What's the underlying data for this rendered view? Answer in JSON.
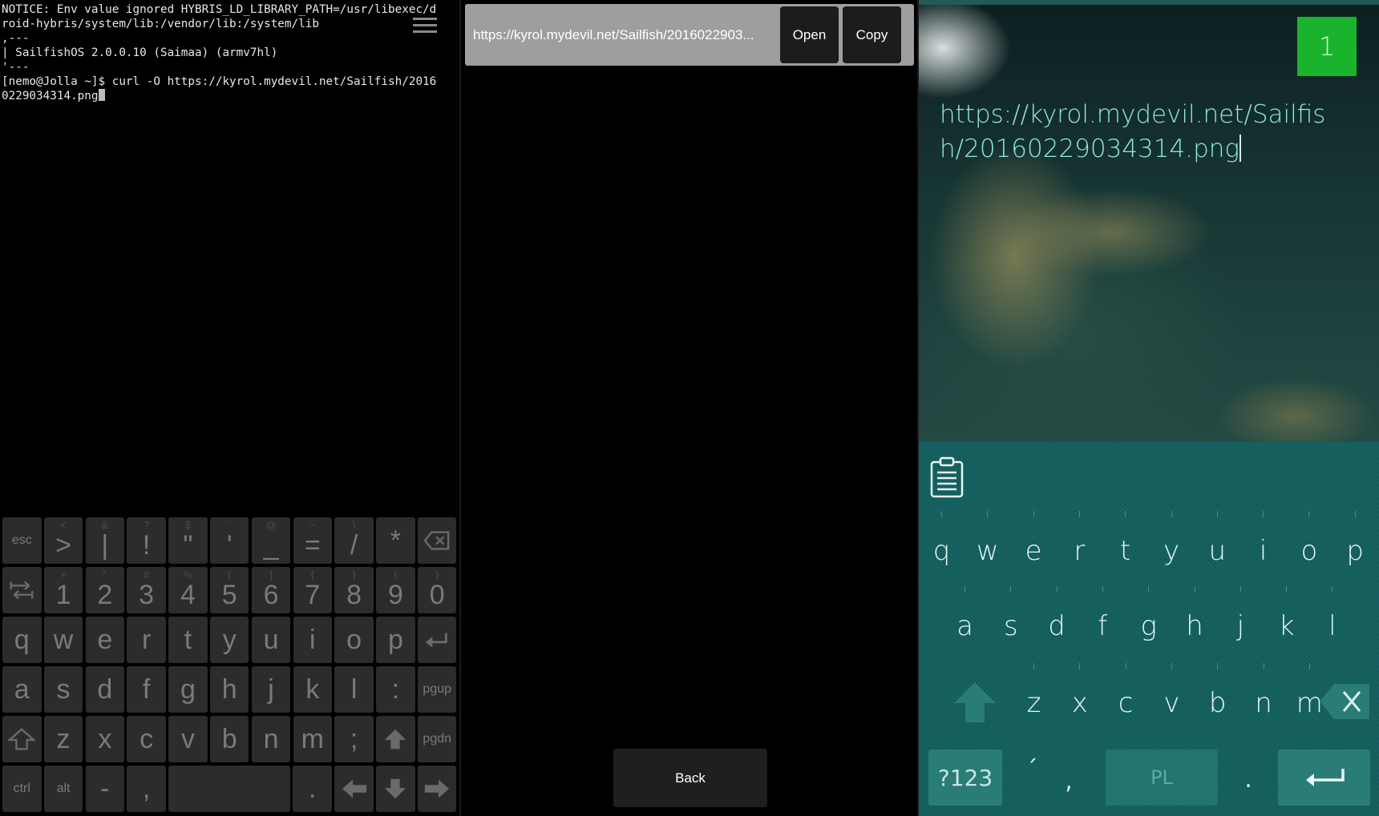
{
  "terminal": {
    "lines": [
      "NOTICE: Env value ignored HYBRIS_LD_LIBRARY_PATH=/usr/libexec/d",
      "roid-hybris/system/lib:/vendor/lib:/system/lib",
      ",---",
      "| SailfishOS 2.0.0.10 (Saimaa) (armv7hl)",
      "'---",
      "[nemo@Jolla ~]$ curl -O https://kyrol.mydevil.net/Sailfish/2016",
      "0229034314.png"
    ],
    "keyboard": {
      "row1": [
        {
          "main": "esc",
          "sup": "",
          "small": true,
          "name": "esc"
        },
        {
          "main": ">",
          "sup": "<",
          "name": "greater"
        },
        {
          "main": "|",
          "sup": "&",
          "name": "pipe"
        },
        {
          "main": "!",
          "sup": "?",
          "name": "exclaim"
        },
        {
          "main": "\"",
          "sup": "$",
          "name": "quote"
        },
        {
          "main": "'",
          "sup": "`",
          "name": "apostrophe"
        },
        {
          "main": "_",
          "sup": "@",
          "name": "underscore"
        },
        {
          "main": "=",
          "sup": "~",
          "name": "equals"
        },
        {
          "main": "/",
          "sup": "\\",
          "name": "slash"
        },
        {
          "main": "*",
          "sup": "",
          "name": "asterisk"
        },
        {
          "main": "",
          "sup": "",
          "icon": "backspace",
          "name": "backspace"
        }
      ],
      "row2": [
        {
          "main": "",
          "sup": "",
          "icon": "tab",
          "name": "tab"
        },
        {
          "main": "1",
          "sup": "+",
          "name": "1"
        },
        {
          "main": "2",
          "sup": "^",
          "name": "2"
        },
        {
          "main": "3",
          "sup": "#",
          "name": "3"
        },
        {
          "main": "4",
          "sup": "%",
          "name": "4"
        },
        {
          "main": "5",
          "sup": "[",
          "name": "5"
        },
        {
          "main": "6",
          "sup": "]",
          "name": "6"
        },
        {
          "main": "7",
          "sup": "{",
          "name": "7"
        },
        {
          "main": "8",
          "sup": "}",
          "name": "8"
        },
        {
          "main": "9",
          "sup": "(",
          "name": "9"
        },
        {
          "main": "0",
          "sup": ")",
          "name": "0"
        }
      ],
      "row3": [
        {
          "main": "q",
          "name": "q"
        },
        {
          "main": "w",
          "name": "w"
        },
        {
          "main": "e",
          "name": "e"
        },
        {
          "main": "r",
          "name": "r"
        },
        {
          "main": "t",
          "name": "t"
        },
        {
          "main": "y",
          "name": "y"
        },
        {
          "main": "u",
          "name": "u"
        },
        {
          "main": "i",
          "name": "i"
        },
        {
          "main": "o",
          "name": "o"
        },
        {
          "main": "p",
          "name": "p"
        },
        {
          "main": "",
          "icon": "enter",
          "name": "enter"
        }
      ],
      "row4": [
        {
          "main": "a",
          "name": "a"
        },
        {
          "main": "s",
          "name": "s"
        },
        {
          "main": "d",
          "name": "d"
        },
        {
          "main": "f",
          "name": "f"
        },
        {
          "main": "g",
          "name": "g"
        },
        {
          "main": "h",
          "name": "h"
        },
        {
          "main": "j",
          "name": "j"
        },
        {
          "main": "k",
          "name": "k"
        },
        {
          "main": "l",
          "name": "l"
        },
        {
          "main": ":",
          "name": "colon"
        },
        {
          "main": "pgup",
          "small": true,
          "name": "pgup"
        }
      ],
      "row5": [
        {
          "main": "",
          "icon": "shift",
          "name": "shift"
        },
        {
          "main": "z",
          "name": "z"
        },
        {
          "main": "x",
          "name": "x"
        },
        {
          "main": "c",
          "name": "c"
        },
        {
          "main": "v",
          "name": "v"
        },
        {
          "main": "b",
          "name": "b"
        },
        {
          "main": "n",
          "name": "n"
        },
        {
          "main": "m",
          "name": "m"
        },
        {
          "main": ";",
          "name": "semicolon"
        },
        {
          "main": "",
          "icon": "up",
          "name": "arrow-up"
        },
        {
          "main": "pgdn",
          "small": true,
          "name": "pgdn"
        }
      ],
      "row6": [
        {
          "main": "ctrl",
          "small": true,
          "name": "ctrl"
        },
        {
          "main": "alt",
          "small": true,
          "name": "alt"
        },
        {
          "main": "-",
          "name": "dash"
        },
        {
          "main": ",",
          "name": "comma"
        },
        {
          "main": "",
          "space": true,
          "name": "space"
        },
        {
          "main": ".",
          "name": "period"
        },
        {
          "main": "",
          "icon": "left",
          "name": "arrow-left"
        },
        {
          "main": "",
          "icon": "down",
          "name": "arrow-down"
        },
        {
          "main": "",
          "icon": "right",
          "name": "arrow-right"
        }
      ]
    }
  },
  "middle": {
    "url": "https://kyrol.mydevil.net/Sailfish/2016022903...",
    "open_label": "Open",
    "copy_label": "Copy",
    "back_label": "Back"
  },
  "sailfish": {
    "badge": "1",
    "url": "https://kyrol.mydevil.net/Sailfish/20160229034314.png",
    "row1": [
      "q",
      "w",
      "e",
      "r",
      "t",
      "y",
      "u",
      "i",
      "o",
      "p"
    ],
    "row2": [
      "a",
      "s",
      "d",
      "f",
      "g",
      "h",
      "j",
      "k",
      "l"
    ],
    "row3": [
      "z",
      "x",
      "c",
      "v",
      "b",
      "n",
      "m"
    ],
    "symbols_label": "?123",
    "accent_label": "´",
    "comma_label": ",",
    "lang_label": "PL",
    "period_label": "."
  }
}
